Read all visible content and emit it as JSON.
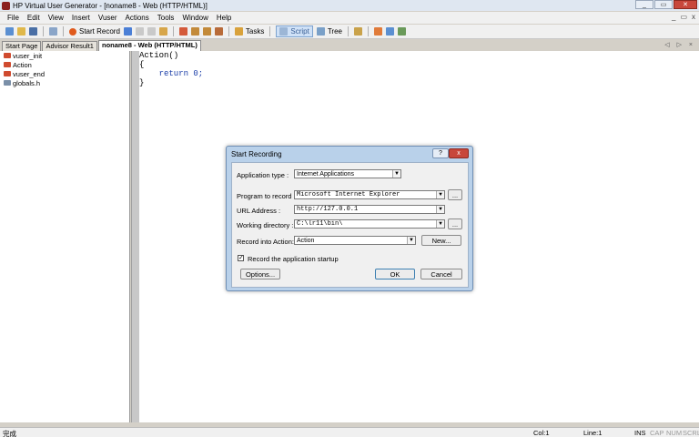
{
  "window": {
    "title": "HP Virtual User Generator - [noname8 - Web (HTTP/HTML)]",
    "min_label": "_",
    "max_label": "▭",
    "close_label": "✕"
  },
  "menu": {
    "items": [
      "File",
      "Edit",
      "View",
      "Insert",
      "Vuser",
      "Actions",
      "Tools",
      "Window",
      "Help"
    ],
    "right_controls": [
      "_",
      "▭",
      "x"
    ]
  },
  "toolbar": {
    "start_record_label": "Start Record",
    "tasks_label": "Tasks",
    "script_label": "Script",
    "tree_label": "Tree"
  },
  "tabs": {
    "items": [
      "Start Page",
      "Advisor Result1",
      "noname8 - Web (HTTP/HTML)"
    ],
    "arrows": "◁ ▷ ×"
  },
  "tree": {
    "items": [
      "vuser_init",
      "Action",
      "vuser_end",
      "globals.h"
    ]
  },
  "editor": {
    "lines": [
      "Action()",
      "{",
      "    return 0;",
      "}"
    ]
  },
  "dialog": {
    "title": "Start Recording",
    "help_label": "?",
    "close_label": "x",
    "application_type_label": "Application type :",
    "application_type_value": "Internet Applications",
    "program_label": "Program to record :",
    "program_value": "Microsoft Internet Explorer",
    "url_label": "URL Address :",
    "url_value": "http://127.0.0.1",
    "workdir_label": "Working directory :",
    "workdir_value": "C:\\lr11\\bin\\",
    "record_into_label": "Record into Action:",
    "record_into_value": "Action",
    "new_button": "New...",
    "browse_button": "...",
    "startup_checkbox_label": "Record the application startup",
    "startup_checked": true,
    "options_button": "Options...",
    "ok_button": "OK",
    "cancel_button": "Cancel"
  },
  "status": {
    "left_text": "完成",
    "col": "Col:1",
    "line": "Line:1",
    "ins": "INS",
    "cap": "CAP",
    "num": "NUM",
    "scrl": "SCRL"
  }
}
